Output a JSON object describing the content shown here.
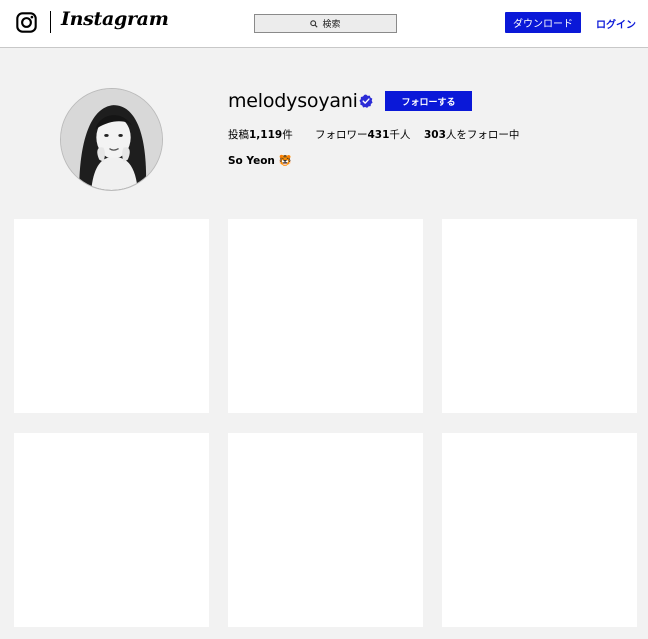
{
  "header": {
    "brand": "Instagram",
    "search_placeholder": "検索",
    "download_label": "ダウンロード",
    "login_label": "ログイン"
  },
  "profile": {
    "username": "melodysoyani",
    "follow_label": "フォローする",
    "posts_label": "投稿",
    "posts_value": "1,119",
    "posts_suffix": "件",
    "followers_label": "フォロワー",
    "followers_value": "431",
    "followers_suffix": "千人",
    "following_value": "303",
    "following_suffix": "人をフォロー中",
    "full_name": "So Yeon 🐯"
  },
  "colors": {
    "accent": "#0a18d8",
    "verified": "#2c2cd6",
    "background": "#f2f2f2",
    "tile": "#ffffff"
  },
  "icons": [
    "instagram-logo-icon",
    "search-icon",
    "verified-badge-icon"
  ],
  "posts_grid": [
    {
      "name": "post-1"
    },
    {
      "name": "post-2"
    },
    {
      "name": "post-3"
    },
    {
      "name": "post-4"
    },
    {
      "name": "post-5"
    },
    {
      "name": "post-6"
    }
  ]
}
